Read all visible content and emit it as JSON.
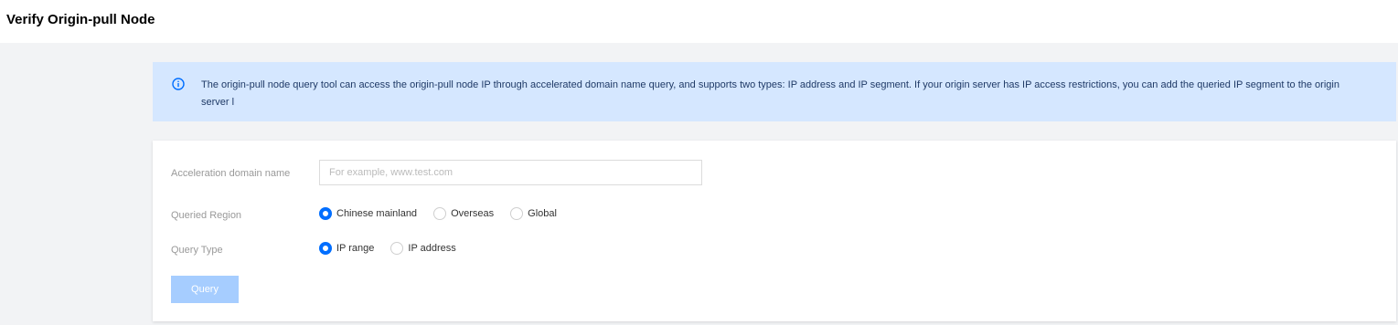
{
  "header": {
    "title": "Verify Origin-pull Node"
  },
  "notice": {
    "text": "The origin-pull node query tool can access the origin-pull node IP through accelerated domain name query, and supports two types: IP address and IP segment. If your origin server has IP access restrictions, you can add the queried IP segment to the origin server l",
    "icon": "info-icon",
    "accent_color": "#006eff",
    "background_color": "#d5e7ff"
  },
  "form": {
    "domain": {
      "label": "Acceleration domain name",
      "value": "",
      "placeholder": "For example, www.test.com"
    },
    "region": {
      "label": "Queried Region",
      "selected": "Chinese mainland",
      "options": [
        "Chinese mainland",
        "Overseas",
        "Global"
      ]
    },
    "query_type": {
      "label": "Query Type",
      "selected": "IP range",
      "options": [
        "IP range",
        "IP address"
      ]
    },
    "query_button": {
      "label": "Query",
      "disabled": true
    }
  }
}
